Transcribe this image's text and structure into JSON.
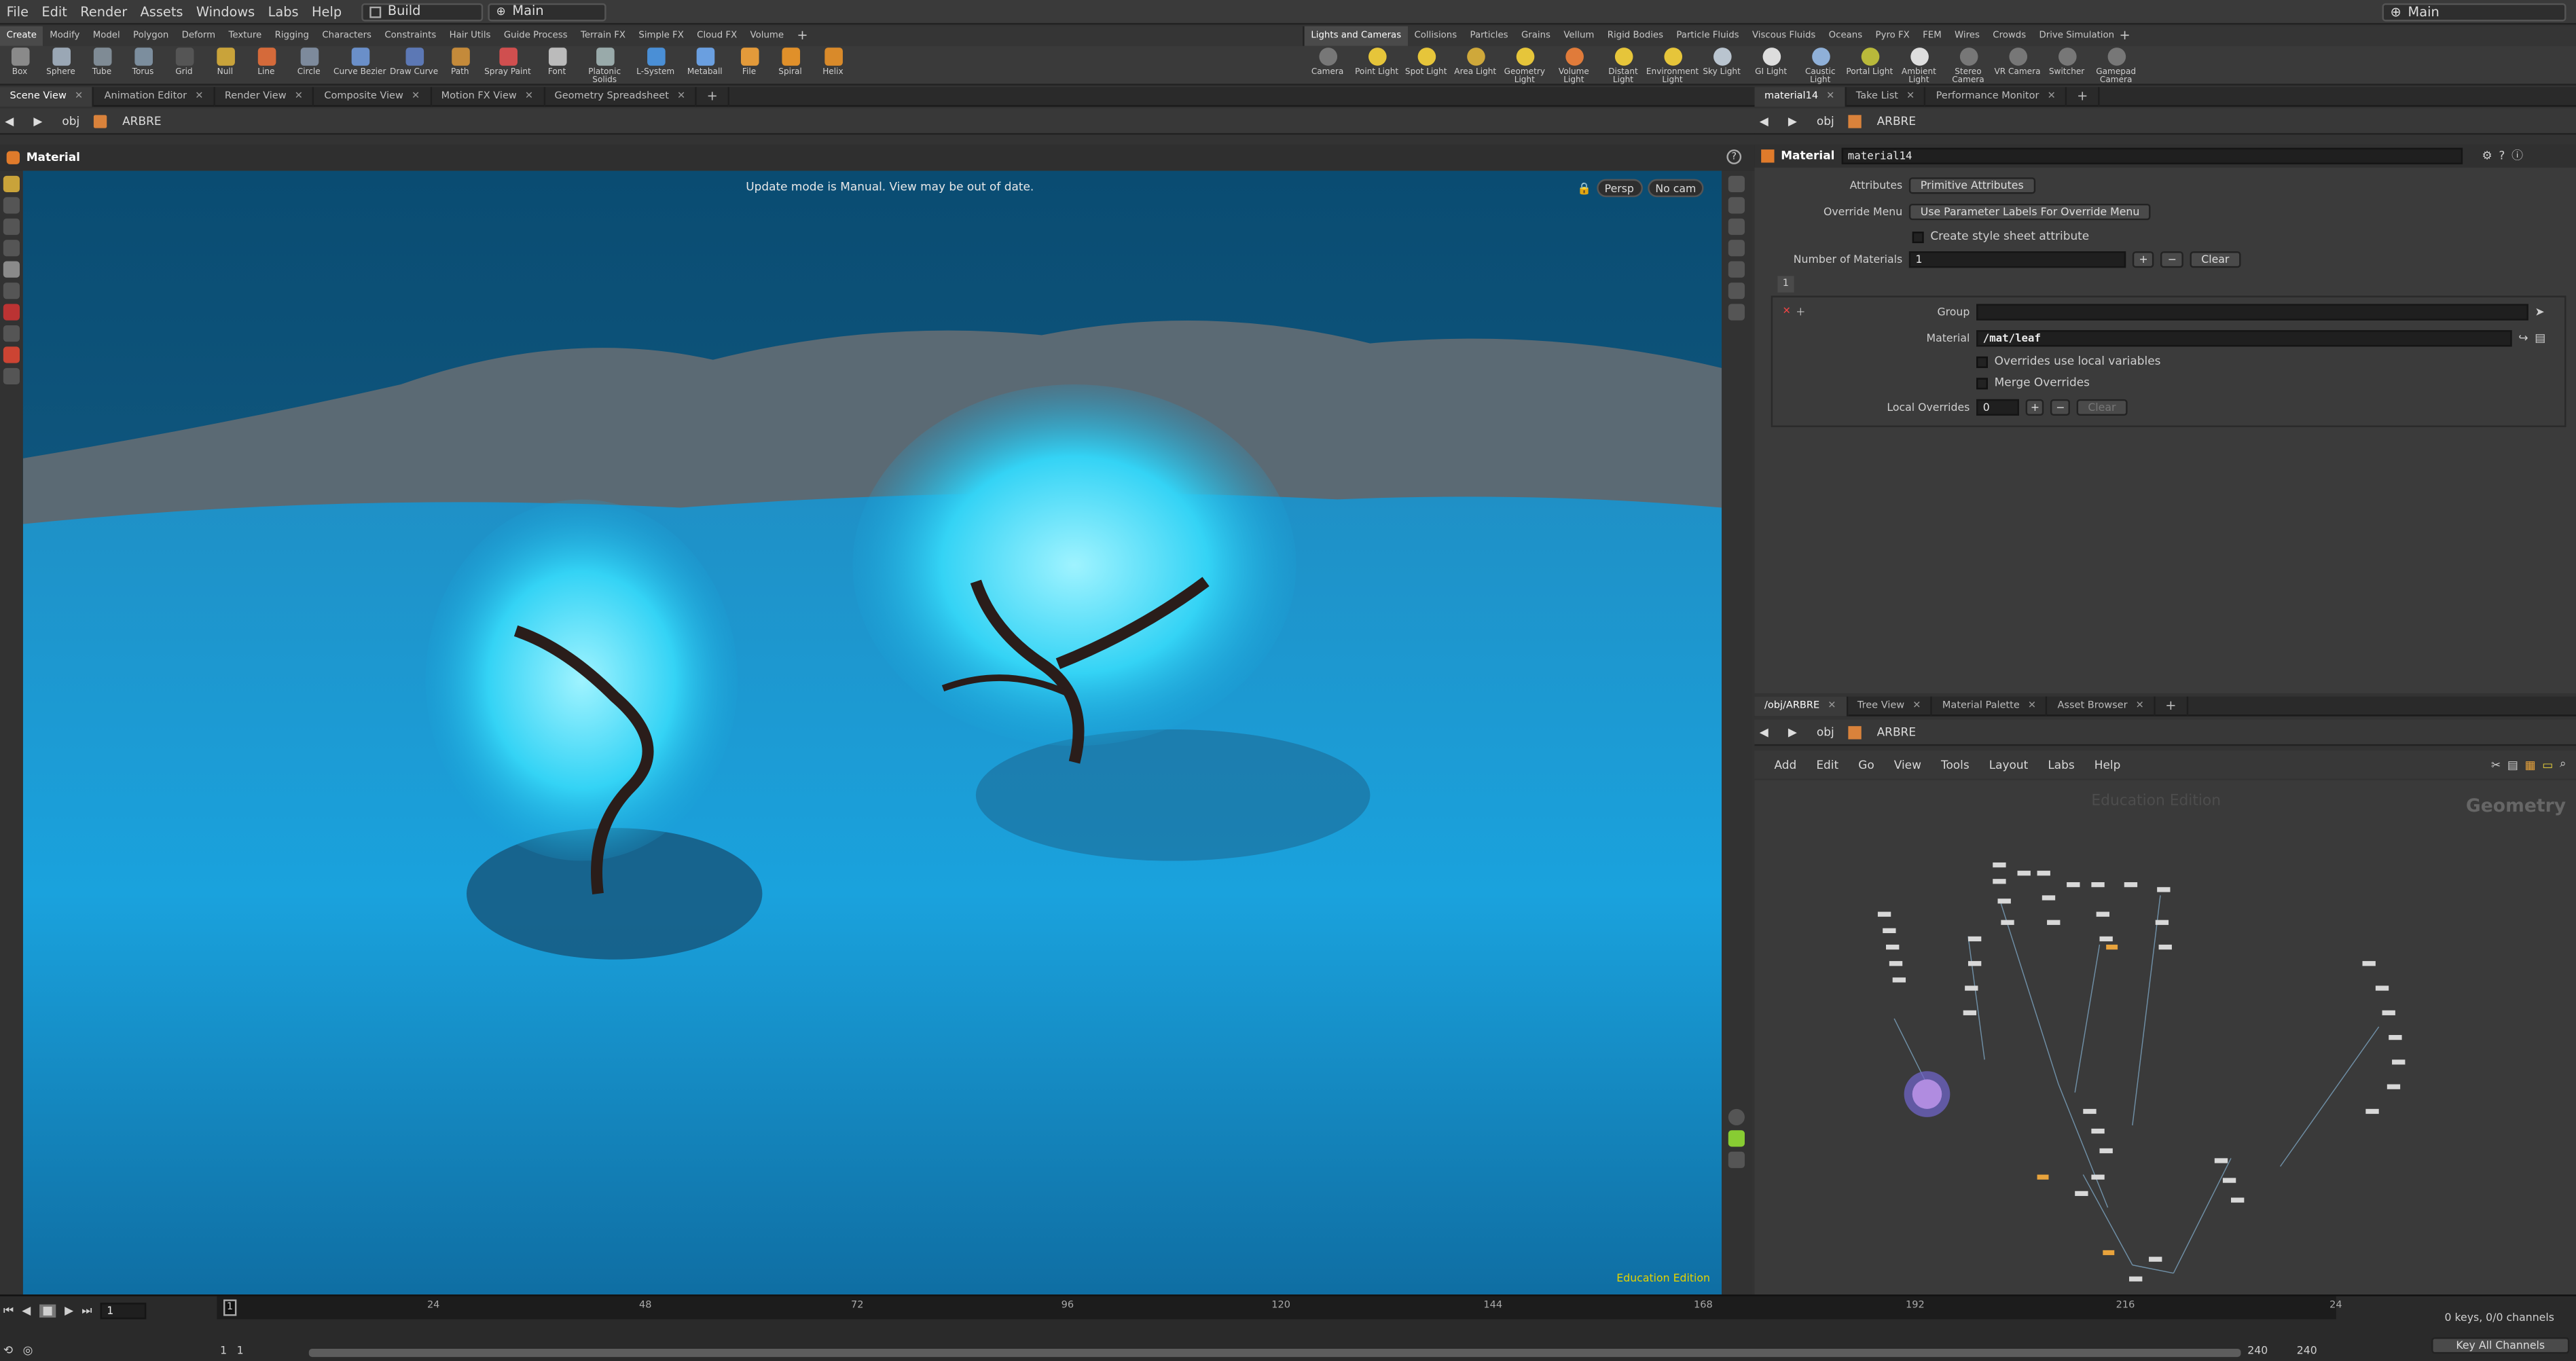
{
  "menubar": {
    "items": [
      "File",
      "Edit",
      "Render",
      "Assets",
      "Windows",
      "Labs",
      "Help"
    ],
    "build_dropdown": "Build",
    "main_dropdown": "Main",
    "right_desktop": "Main"
  },
  "shelf": {
    "left_tabs": [
      "Create",
      "Modify",
      "Model",
      "Polygon",
      "Deform",
      "Texture",
      "Rigging",
      "Characters",
      "Constraints",
      "Hair Utils",
      "Guide Process",
      "Terrain FX",
      "Simple FX",
      "Cloud FX",
      "Volume"
    ],
    "right_tabs": [
      "Lights and Cameras",
      "Collisions",
      "Particles",
      "Grains",
      "Vellum",
      "Rigid Bodies",
      "Particle Fluids",
      "Viscous Fluids",
      "Oceans",
      "Pyro FX",
      "FEM",
      "Wires",
      "Crowds",
      "Drive Simulation"
    ],
    "left_tools": [
      "Box",
      "Sphere",
      "Tube",
      "Torus",
      "Grid",
      "Null",
      "Line",
      "Circle",
      "Curve Bezier",
      "Draw Curve",
      "Path",
      "Spray Paint",
      "Font",
      "Platonic Solids",
      "L-System",
      "Metaball",
      "File",
      "Spiral",
      "Helix"
    ],
    "right_tools": [
      "Camera",
      "Point Light",
      "Spot Light",
      "Area Light",
      "Geometry Light",
      "Volume Light",
      "Distant Light",
      "Environment Light",
      "Sky Light",
      "GI Light",
      "Caustic Light",
      "Portal Light",
      "Ambient Light",
      "Stereo Camera",
      "VR Camera",
      "Switcher",
      "Gamepad Camera"
    ]
  },
  "left_pane": {
    "tabs": [
      "Scene View",
      "Animation Editor",
      "Render View",
      "Composite View",
      "Motion FX View",
      "Geometry Spreadsheet"
    ],
    "path_obj": "obj",
    "path_node": "ARBRE",
    "title": "Material",
    "status": "Update mode is Manual. View may be out of date.",
    "persp": "Persp",
    "cam": "No cam",
    "edition": "Education Edition"
  },
  "params": {
    "tabs": [
      "material14",
      "Take List",
      "Performance Monitor"
    ],
    "path_obj": "obj",
    "path_node": "ARBRE",
    "node_type": "Material",
    "node_name": "material14",
    "attributes_label": "Attributes",
    "attributes_value": "Primitive Attributes",
    "override_label": "Override Menu",
    "override_value": "Use Parameter Labels For Override Menu",
    "stylesheet_label": "Create style sheet attribute",
    "nummat_label": "Number of Materials",
    "nummat_value": "1",
    "clear_label": "Clear",
    "tab_index": "1",
    "group_label": "Group",
    "group_value": "",
    "material_label": "Material",
    "material_value": "/mat/leaf",
    "overrides_local": "Overrides use local variables",
    "merge_overrides": "Merge Overrides",
    "local_overrides_label": "Local Overrides",
    "local_overrides_value": "0",
    "clear2_label": "Clear"
  },
  "network": {
    "tabs": [
      "/obj/ARBRE",
      "Tree View",
      "Material Palette",
      "Asset Browser"
    ],
    "path_obj": "obj",
    "path_node": "ARBRE",
    "menu": [
      "Add",
      "Edit",
      "Go",
      "View",
      "Tools",
      "Layout",
      "Labs",
      "Help"
    ],
    "watermark": "Education Edition",
    "context": "Geometry"
  },
  "timeline": {
    "ticks": [
      "24",
      "48",
      "72",
      "96",
      "120",
      "144",
      "168",
      "192",
      "216",
      "24"
    ],
    "start_marker": "1",
    "frame": "1",
    "range_start": "1",
    "range_start2": "1",
    "range_end": "240",
    "range_end2": "240",
    "keys": "0 keys, 0/0 channels",
    "key_all": "Key All Channels"
  },
  "colors": {
    "accent": "#e8a33c",
    "viewport_sky": "#0e5a86",
    "foliage": "#2ad0ff"
  }
}
